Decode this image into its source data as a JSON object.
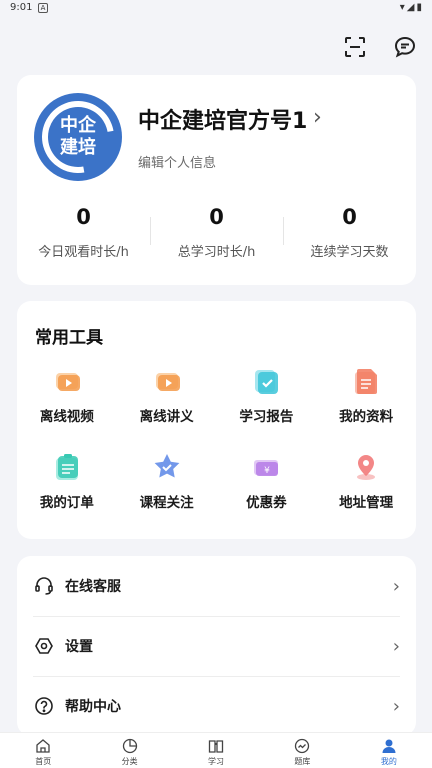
{
  "status_bar": {
    "time": "9:01",
    "sim_label": "A"
  },
  "header": {
    "icons": [
      "scan-icon",
      "message-icon"
    ]
  },
  "profile": {
    "avatar_text": "中企建培",
    "name": "中企建培官方号1",
    "edit_label": "编辑个人信息",
    "stats": [
      {
        "value": "0",
        "label": "今日观看时长/h"
      },
      {
        "value": "0",
        "label": "总学习时长/h"
      },
      {
        "value": "0",
        "label": "连续学习天数"
      }
    ]
  },
  "tools": {
    "title": "常用工具",
    "items": [
      {
        "label": "离线视频",
        "icon": "video-icon",
        "color": "#f39a4a"
      },
      {
        "label": "离线讲义",
        "icon": "video-doc-icon",
        "color": "#f39a4a"
      },
      {
        "label": "学习报告",
        "icon": "report-check-icon",
        "color": "#3cc4d8"
      },
      {
        "label": "我的资料",
        "icon": "document-icon",
        "color": "#f27a5e"
      },
      {
        "label": "我的订单",
        "icon": "order-icon",
        "color": "#37c9b3"
      },
      {
        "label": "课程关注",
        "icon": "star-icon",
        "color": "#5a86e6"
      },
      {
        "label": "优惠券",
        "icon": "coupon-icon",
        "color": "#b57be6"
      },
      {
        "label": "地址管理",
        "icon": "location-icon",
        "color": "#f27a7a"
      }
    ]
  },
  "menu": {
    "items": [
      {
        "label": "在线客服",
        "icon": "headset-icon"
      },
      {
        "label": "设置",
        "icon": "settings-icon"
      },
      {
        "label": "帮助中心",
        "icon": "help-icon"
      }
    ]
  },
  "tabbar": {
    "items": [
      {
        "label": "首页",
        "icon": "home-icon"
      },
      {
        "label": "分类",
        "icon": "category-icon"
      },
      {
        "label": "学习",
        "icon": "book-icon"
      },
      {
        "label": "题库",
        "icon": "question-bank-icon"
      },
      {
        "label": "我的",
        "icon": "user-icon",
        "active": true
      }
    ],
    "active_color": "#2f6fd1"
  }
}
